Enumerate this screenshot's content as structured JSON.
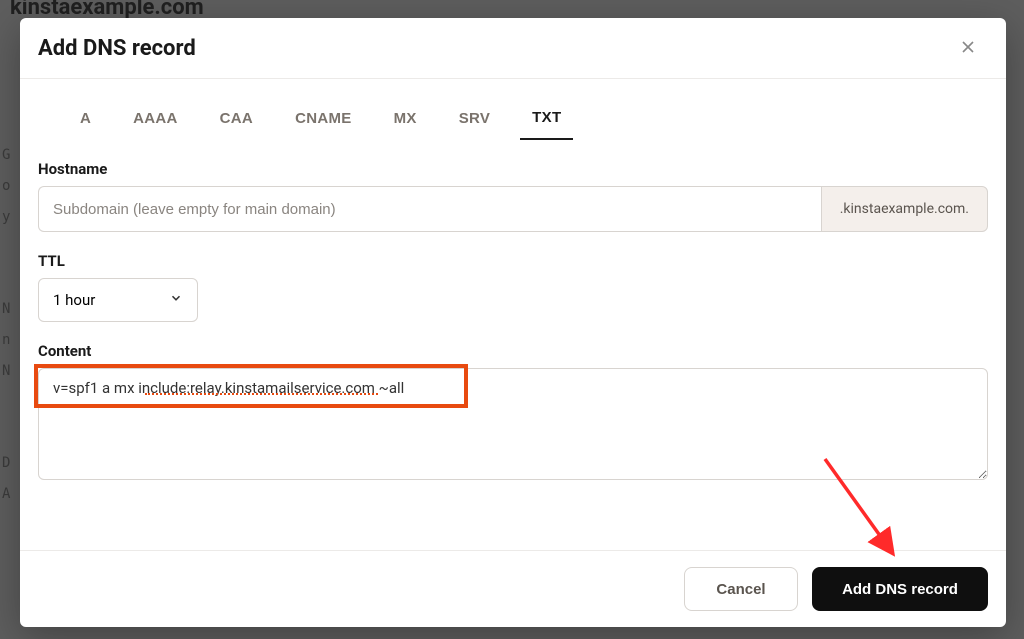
{
  "backdrop": {
    "domain_truncated": "kinstaexample.com",
    "left_chars": "G\no\ny\n\n\nN\nn\nN\n\n\nD\nA"
  },
  "modal": {
    "title": "Add DNS record",
    "tabs": [
      "A",
      "AAAA",
      "CAA",
      "CNAME",
      "MX",
      "SRV",
      "TXT"
    ],
    "active_tab_index": 6,
    "hostname": {
      "label": "Hostname",
      "value": "",
      "placeholder": "Subdomain (leave empty for main domain)",
      "suffix": ".kinstaexample.com."
    },
    "ttl": {
      "label": "TTL",
      "value": "1 hour"
    },
    "content": {
      "label": "Content",
      "value": "v=spf1 a mx include:relay.kinstamailservice.com ~all"
    },
    "buttons": {
      "cancel": "Cancel",
      "submit": "Add DNS record"
    }
  },
  "annotation": {
    "highlight_color": "#e84a10",
    "arrow_color": "#ff2a2a"
  }
}
